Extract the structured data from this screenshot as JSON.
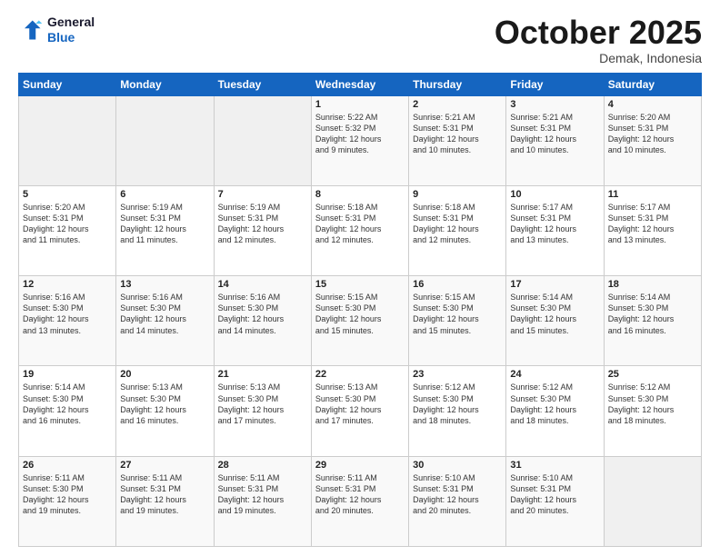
{
  "header": {
    "logo_line1": "General",
    "logo_line2": "Blue",
    "month": "October 2025",
    "location": "Demak, Indonesia"
  },
  "days_of_week": [
    "Sunday",
    "Monday",
    "Tuesday",
    "Wednesday",
    "Thursday",
    "Friday",
    "Saturday"
  ],
  "weeks": [
    [
      {
        "num": "",
        "data": ""
      },
      {
        "num": "",
        "data": ""
      },
      {
        "num": "",
        "data": ""
      },
      {
        "num": "1",
        "data": "Sunrise: 5:22 AM\nSunset: 5:32 PM\nDaylight: 12 hours\nand 9 minutes."
      },
      {
        "num": "2",
        "data": "Sunrise: 5:21 AM\nSunset: 5:31 PM\nDaylight: 12 hours\nand 10 minutes."
      },
      {
        "num": "3",
        "data": "Sunrise: 5:21 AM\nSunset: 5:31 PM\nDaylight: 12 hours\nand 10 minutes."
      },
      {
        "num": "4",
        "data": "Sunrise: 5:20 AM\nSunset: 5:31 PM\nDaylight: 12 hours\nand 10 minutes."
      }
    ],
    [
      {
        "num": "5",
        "data": "Sunrise: 5:20 AM\nSunset: 5:31 PM\nDaylight: 12 hours\nand 11 minutes."
      },
      {
        "num": "6",
        "data": "Sunrise: 5:19 AM\nSunset: 5:31 PM\nDaylight: 12 hours\nand 11 minutes."
      },
      {
        "num": "7",
        "data": "Sunrise: 5:19 AM\nSunset: 5:31 PM\nDaylight: 12 hours\nand 12 minutes."
      },
      {
        "num": "8",
        "data": "Sunrise: 5:18 AM\nSunset: 5:31 PM\nDaylight: 12 hours\nand 12 minutes."
      },
      {
        "num": "9",
        "data": "Sunrise: 5:18 AM\nSunset: 5:31 PM\nDaylight: 12 hours\nand 12 minutes."
      },
      {
        "num": "10",
        "data": "Sunrise: 5:17 AM\nSunset: 5:31 PM\nDaylight: 12 hours\nand 13 minutes."
      },
      {
        "num": "11",
        "data": "Sunrise: 5:17 AM\nSunset: 5:31 PM\nDaylight: 12 hours\nand 13 minutes."
      }
    ],
    [
      {
        "num": "12",
        "data": "Sunrise: 5:16 AM\nSunset: 5:30 PM\nDaylight: 12 hours\nand 13 minutes."
      },
      {
        "num": "13",
        "data": "Sunrise: 5:16 AM\nSunset: 5:30 PM\nDaylight: 12 hours\nand 14 minutes."
      },
      {
        "num": "14",
        "data": "Sunrise: 5:16 AM\nSunset: 5:30 PM\nDaylight: 12 hours\nand 14 minutes."
      },
      {
        "num": "15",
        "data": "Sunrise: 5:15 AM\nSunset: 5:30 PM\nDaylight: 12 hours\nand 15 minutes."
      },
      {
        "num": "16",
        "data": "Sunrise: 5:15 AM\nSunset: 5:30 PM\nDaylight: 12 hours\nand 15 minutes."
      },
      {
        "num": "17",
        "data": "Sunrise: 5:14 AM\nSunset: 5:30 PM\nDaylight: 12 hours\nand 15 minutes."
      },
      {
        "num": "18",
        "data": "Sunrise: 5:14 AM\nSunset: 5:30 PM\nDaylight: 12 hours\nand 16 minutes."
      }
    ],
    [
      {
        "num": "19",
        "data": "Sunrise: 5:14 AM\nSunset: 5:30 PM\nDaylight: 12 hours\nand 16 minutes."
      },
      {
        "num": "20",
        "data": "Sunrise: 5:13 AM\nSunset: 5:30 PM\nDaylight: 12 hours\nand 16 minutes."
      },
      {
        "num": "21",
        "data": "Sunrise: 5:13 AM\nSunset: 5:30 PM\nDaylight: 12 hours\nand 17 minutes."
      },
      {
        "num": "22",
        "data": "Sunrise: 5:13 AM\nSunset: 5:30 PM\nDaylight: 12 hours\nand 17 minutes."
      },
      {
        "num": "23",
        "data": "Sunrise: 5:12 AM\nSunset: 5:30 PM\nDaylight: 12 hours\nand 18 minutes."
      },
      {
        "num": "24",
        "data": "Sunrise: 5:12 AM\nSunset: 5:30 PM\nDaylight: 12 hours\nand 18 minutes."
      },
      {
        "num": "25",
        "data": "Sunrise: 5:12 AM\nSunset: 5:30 PM\nDaylight: 12 hours\nand 18 minutes."
      }
    ],
    [
      {
        "num": "26",
        "data": "Sunrise: 5:11 AM\nSunset: 5:30 PM\nDaylight: 12 hours\nand 19 minutes."
      },
      {
        "num": "27",
        "data": "Sunrise: 5:11 AM\nSunset: 5:31 PM\nDaylight: 12 hours\nand 19 minutes."
      },
      {
        "num": "28",
        "data": "Sunrise: 5:11 AM\nSunset: 5:31 PM\nDaylight: 12 hours\nand 19 minutes."
      },
      {
        "num": "29",
        "data": "Sunrise: 5:11 AM\nSunset: 5:31 PM\nDaylight: 12 hours\nand 20 minutes."
      },
      {
        "num": "30",
        "data": "Sunrise: 5:10 AM\nSunset: 5:31 PM\nDaylight: 12 hours\nand 20 minutes."
      },
      {
        "num": "31",
        "data": "Sunrise: 5:10 AM\nSunset: 5:31 PM\nDaylight: 12 hours\nand 20 minutes."
      },
      {
        "num": "",
        "data": ""
      }
    ]
  ]
}
